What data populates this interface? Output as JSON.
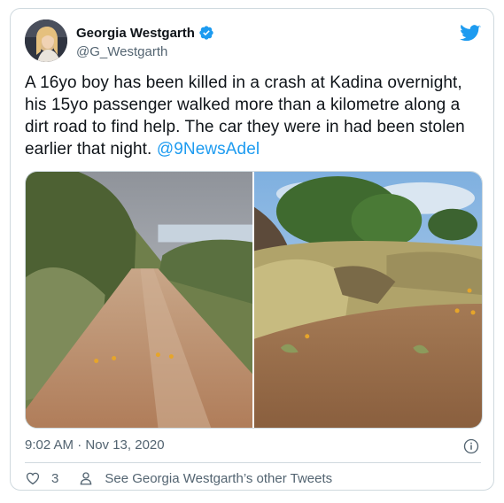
{
  "author": {
    "display_name": "Georgia Westgarth",
    "handle": "@G_Westgarth",
    "verified": true
  },
  "tweet": {
    "text": "A 16yo boy has been killed in a crash at Kadina overnight, his 15yo passenger walked more than a kilometre along a dirt road to find help. The car they were in had been stolen earlier that night. ",
    "mention": "@9NewsAdel",
    "timestamp": "9:02 AM · Nov 13, 2020"
  },
  "media": {
    "photos": [
      "dirt-road-with-bushes",
      "scrubland-with-trees"
    ]
  },
  "actions": {
    "like_count": "3",
    "profile_link": "See Georgia Westgarth’s other Tweets"
  },
  "colors": {
    "accent": "#1d9bf0",
    "text": "#0f1419",
    "muted": "#536471",
    "border": "#cfd9de"
  },
  "icons": [
    "twitter-bird-icon",
    "verified-badge-icon",
    "info-icon",
    "heart-icon",
    "person-icon"
  ]
}
